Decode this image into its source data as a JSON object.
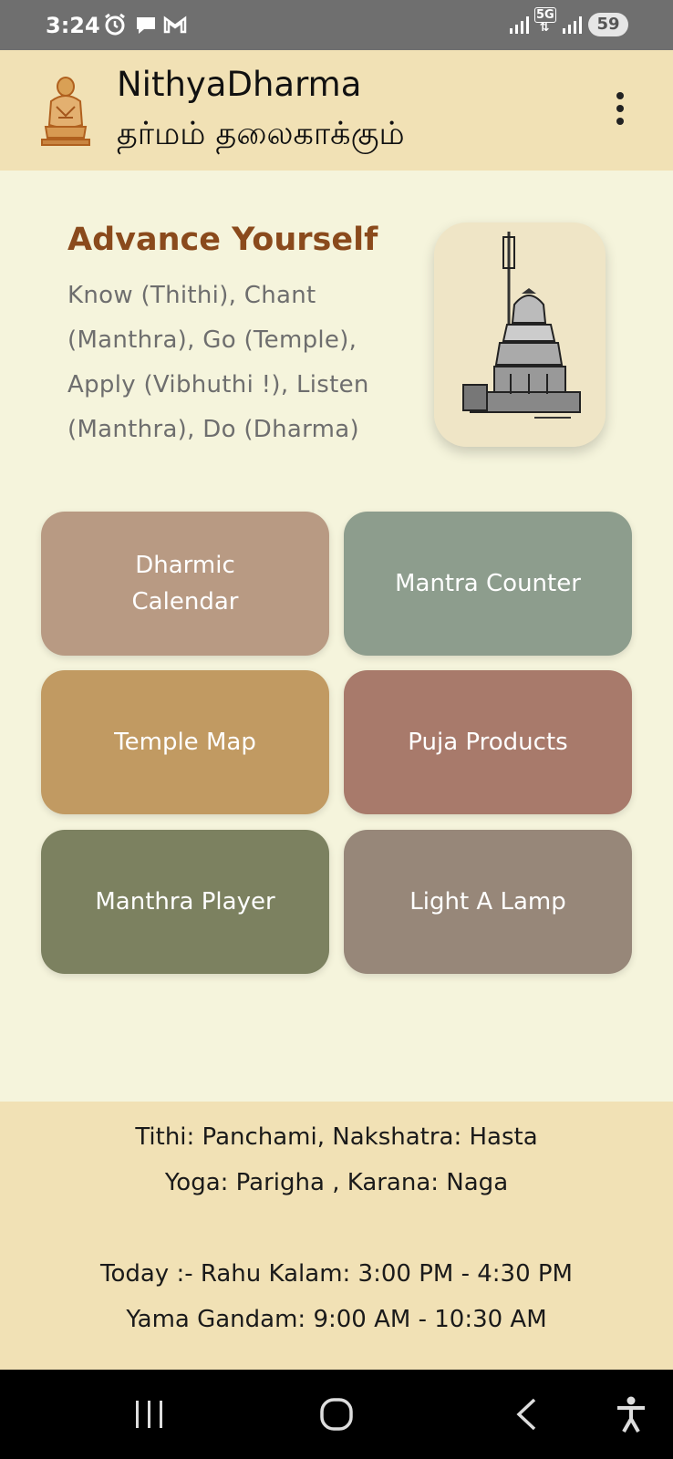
{
  "status_bar": {
    "time": "3:24",
    "left_icons": [
      "alarm-icon",
      "chat-icon",
      "gmail-icon"
    ],
    "right_icons": [
      "signal-icon",
      "5g-icon",
      "signal-icon"
    ],
    "network": "5G",
    "battery": "59"
  },
  "app_bar": {
    "title": "NithyaDharma",
    "subtitle": "தர்மம் தலைகாக்கும்",
    "menu_icon": "more-vert-icon"
  },
  "hero": {
    "title": "Advance Yourself",
    "text": "Know (Thithi), Chant (Manthra), Go (Temple), Apply (Vibhuthi !), Listen (Manthra), Do (Dharma)",
    "image": "temple-sketch-image"
  },
  "tiles": [
    {
      "label": "Dharmic Calendar",
      "color": "#b89a83"
    },
    {
      "label": "Mantra Counter",
      "color": "#8d9d8d"
    },
    {
      "label": "Temple Map",
      "color": "#c19a62"
    },
    {
      "label": "Puja Products",
      "color": "#a87a6b"
    },
    {
      "label": "Manthra Player",
      "color": "#7c8160"
    },
    {
      "label": "Light A Lamp",
      "color": "#978779"
    }
  ],
  "info": {
    "line1": "Tithi: Panchami, Nakshatra: Hasta",
    "line2": "Yoga: Parigha , Karana: Naga",
    "line3": "Today :- Rahu Kalam: 3:00 PM - 4:30 PM",
    "line4": "Yama Gandam: 9:00 AM - 10:30 AM"
  },
  "nav_bar": {
    "icons": [
      "recents-icon",
      "home-icon",
      "back-icon",
      "accessibility-icon"
    ]
  },
  "colors": {
    "background": "#f5f4dc",
    "app_bar": "#f1e1b5",
    "hero_title": "#8a4a1c"
  }
}
